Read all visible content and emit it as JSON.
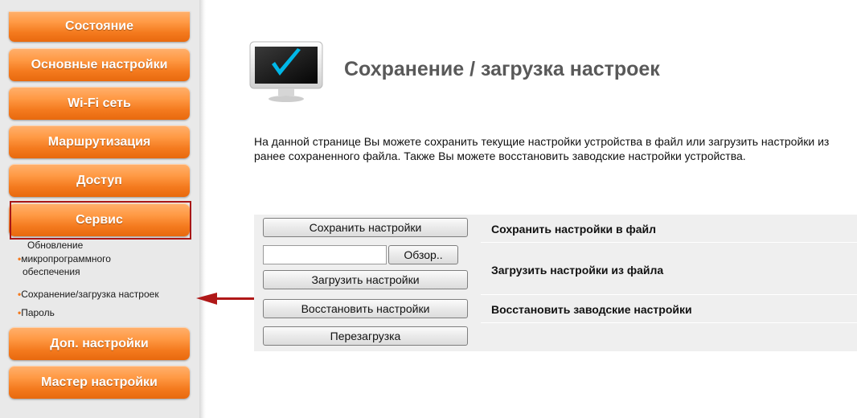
{
  "sidebar": {
    "menu": [
      {
        "label": "Состояние"
      },
      {
        "label": "Основные настройки"
      },
      {
        "label": "Wi-Fi сеть"
      },
      {
        "label": "Маршрутизация"
      },
      {
        "label": "Доступ"
      },
      {
        "label": "Сервис"
      },
      {
        "label": "Доп. настройки"
      },
      {
        "label": "Мастер настройки"
      }
    ],
    "submenu": {
      "firmware_line1": "Обновление",
      "firmware_line2": "микропрограммного",
      "firmware_line3": "обеспечения",
      "backup": "Сохранение/загрузка настроек",
      "password": "Пароль"
    },
    "active_item": "Сервис"
  },
  "page": {
    "title": "Сохранение / загрузка настроек",
    "description": "На данной странице Вы можете сохранить текущие настройки устройства в файл или загрузить настройки из ранее сохраненного файла. Также Вы можете восстановить заводские настройки устройства."
  },
  "actions": {
    "save_button": "Сохранить настройки",
    "save_desc": "Сохранить настройки в файл",
    "browse_button": "Обзор..",
    "file_value": "",
    "load_button": "Загрузить настройки",
    "load_desc": "Загрузить настройки из файла",
    "restore_button": "Восстановить настройки",
    "restore_desc": "Восстановить заводские настройки",
    "reboot_button": "Перезагрузка"
  },
  "colors": {
    "menu_orange": "#f47a1e",
    "active_frame": "#a81616",
    "arrow": "#b01818",
    "title_gray": "#595959",
    "check_cyan": "#00b7e8"
  },
  "icons": {
    "page_icon": "monitor-check-icon",
    "arrow": "arrow-left-icon"
  }
}
